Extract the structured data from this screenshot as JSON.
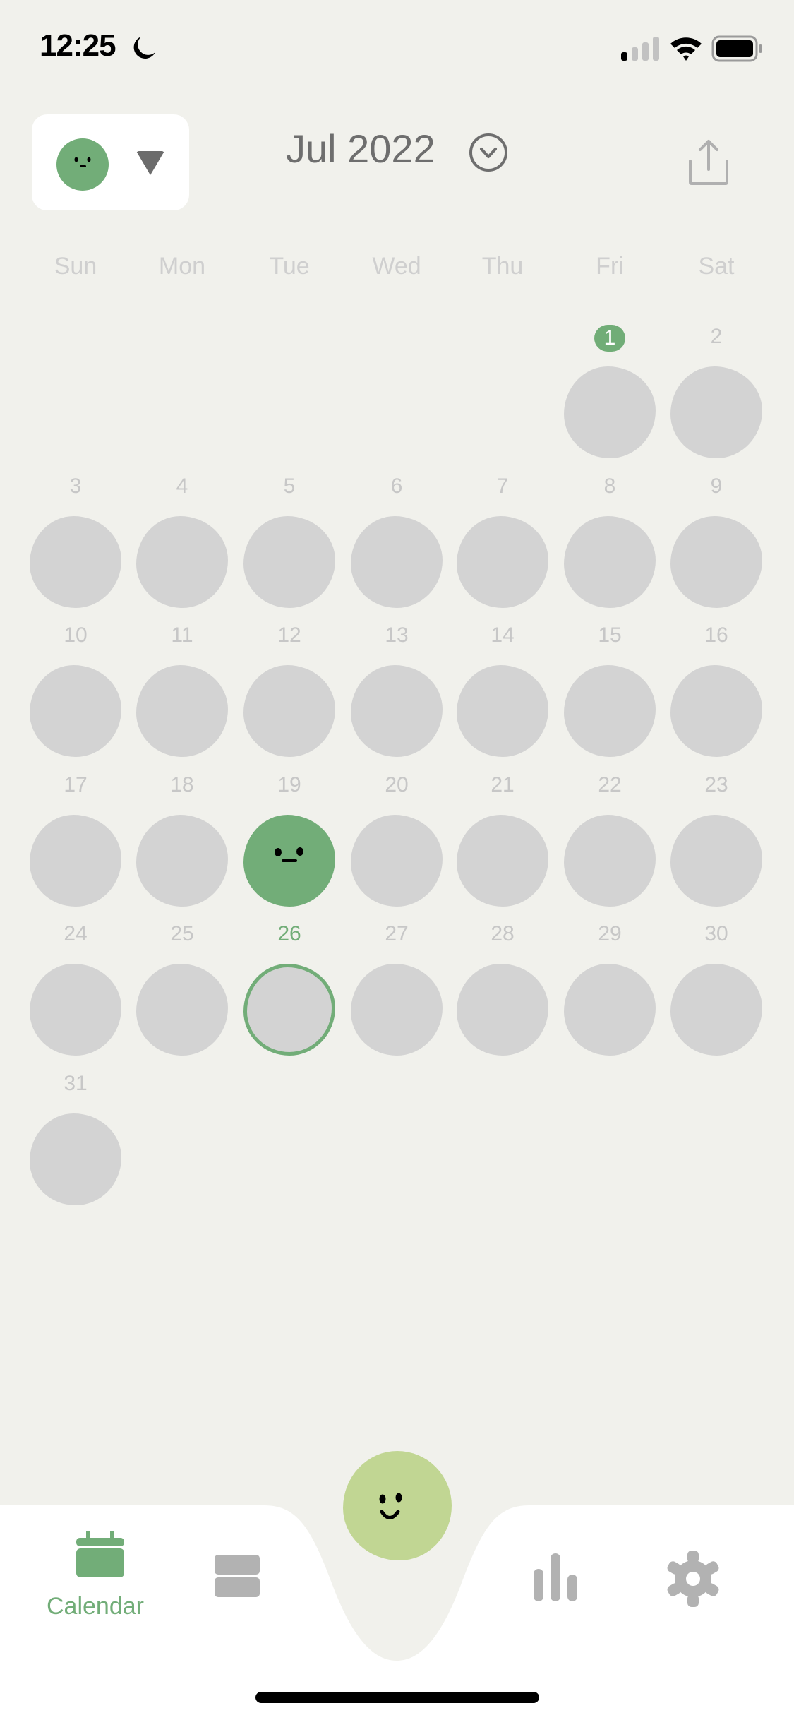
{
  "status_bar": {
    "time": "12:25",
    "focus_icon": "moon-icon",
    "signal_bars": 1,
    "wifi": true,
    "battery_level": 0.85
  },
  "header": {
    "mood_filter": {
      "selected_mood": "neutral",
      "color": "#72ad78"
    },
    "month_label": "Jul 2022",
    "share_icon": "share-icon"
  },
  "calendar": {
    "weekdays": [
      "Sun",
      "Mon",
      "Tue",
      "Wed",
      "Thu",
      "Fri",
      "Sat"
    ],
    "first_weekday_index": 5,
    "days_in_month": 31,
    "badge_day": 1,
    "today": 26,
    "mood_entries": [
      {
        "day": 19,
        "mood": "neutral",
        "color": "#72ad78"
      }
    ],
    "empty_color": "#d3d3d3"
  },
  "tabbar": {
    "items": [
      {
        "name": "calendar",
        "label": "Calendar",
        "active": true
      },
      {
        "name": "list",
        "label": ""
      },
      {
        "name": "add-entry",
        "label": ""
      },
      {
        "name": "stats",
        "label": ""
      },
      {
        "name": "settings",
        "label": ""
      }
    ],
    "accent": "#72ad78",
    "fab_color": "#c1d693"
  }
}
